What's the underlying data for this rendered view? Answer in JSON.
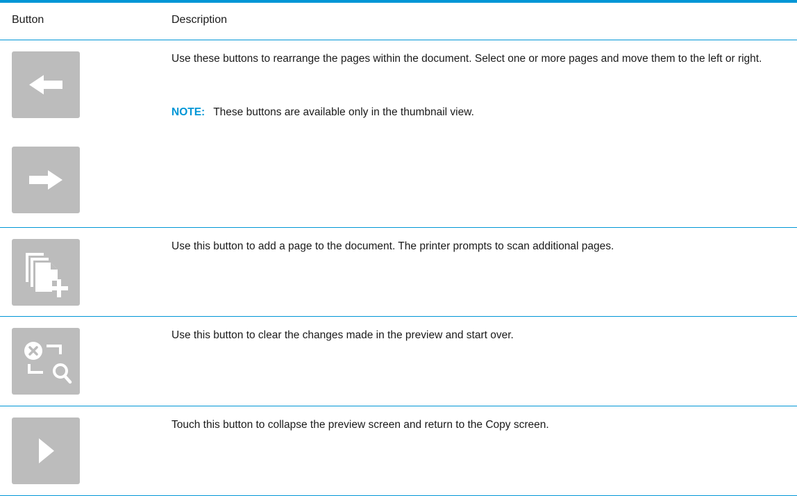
{
  "header": {
    "col_button": "Button",
    "col_description": "Description"
  },
  "rows": [
    {
      "description": "Use these buttons to rearrange the pages within the document. Select one or more pages and move them to the left or right.",
      "note_label": "NOTE:",
      "note_text": "These buttons are available only in the thumbnail view.",
      "icons": [
        "move-left-arrow-icon",
        "move-right-arrow-icon"
      ]
    },
    {
      "description": "Use this button to add a page to the document. The printer prompts to scan additional pages.",
      "icons": [
        "add-page-icon"
      ]
    },
    {
      "description": "Use this button to clear the changes made in the preview and start over.",
      "icons": [
        "reset-preview-icon"
      ]
    },
    {
      "description": "Touch this button to collapse the preview screen and return to the Copy screen.",
      "icons": [
        "collapse-play-icon"
      ]
    }
  ],
  "colors": {
    "rule": "#0096d6",
    "tile": "#bcbcbc",
    "icon": "#ffffff",
    "note_label": "#0096d6"
  }
}
